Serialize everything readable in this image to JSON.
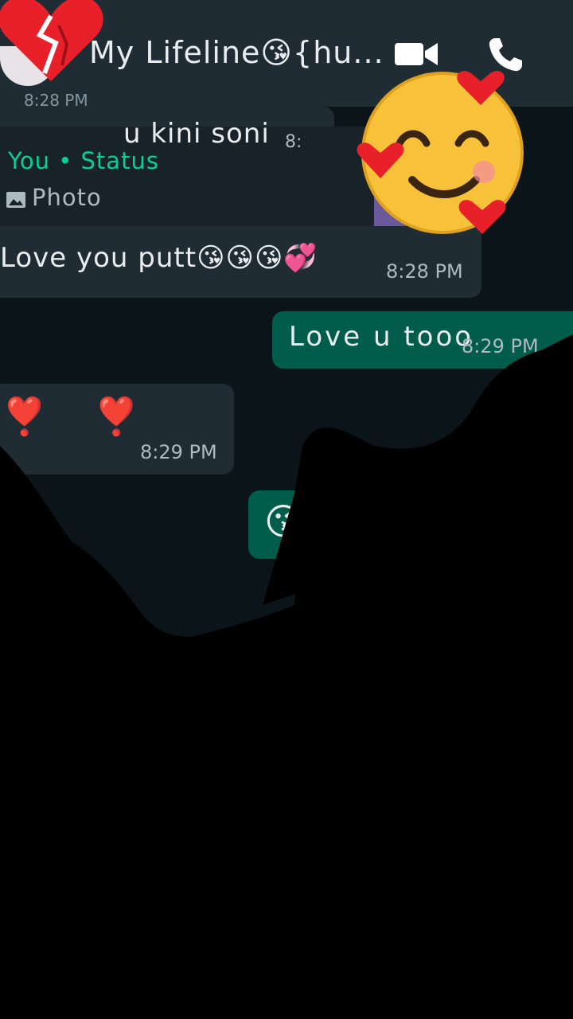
{
  "header": {
    "contact_name": "My Lifeline😘{hu...",
    "video_icon": "video-call-icon",
    "phone_icon": "voice-call-icon"
  },
  "messages": {
    "previous_time": "8:28 PM",
    "status_reply": {
      "quoted_author": "You • Status",
      "quoted_label": "Photo",
      "text": "Love you putt😘😘😘💞",
      "time": "8:28 PM"
    },
    "outgoing_1": {
      "text": "Love u tooo",
      "time": "8:29 PM"
    },
    "incoming_2": {
      "text": "❣️ ❣️",
      "time": "8:29 PM"
    },
    "outgoing_2": {
      "text": "😘"
    },
    "incoming_3": {
      "text": "u kini soni",
      "time": "8:"
    }
  },
  "colors": {
    "header_bg": "#1f2c33",
    "incoming_bubble": "#1f2c33",
    "outgoing_bubble": "#005c4b",
    "status_accent": "#06cf9c"
  }
}
